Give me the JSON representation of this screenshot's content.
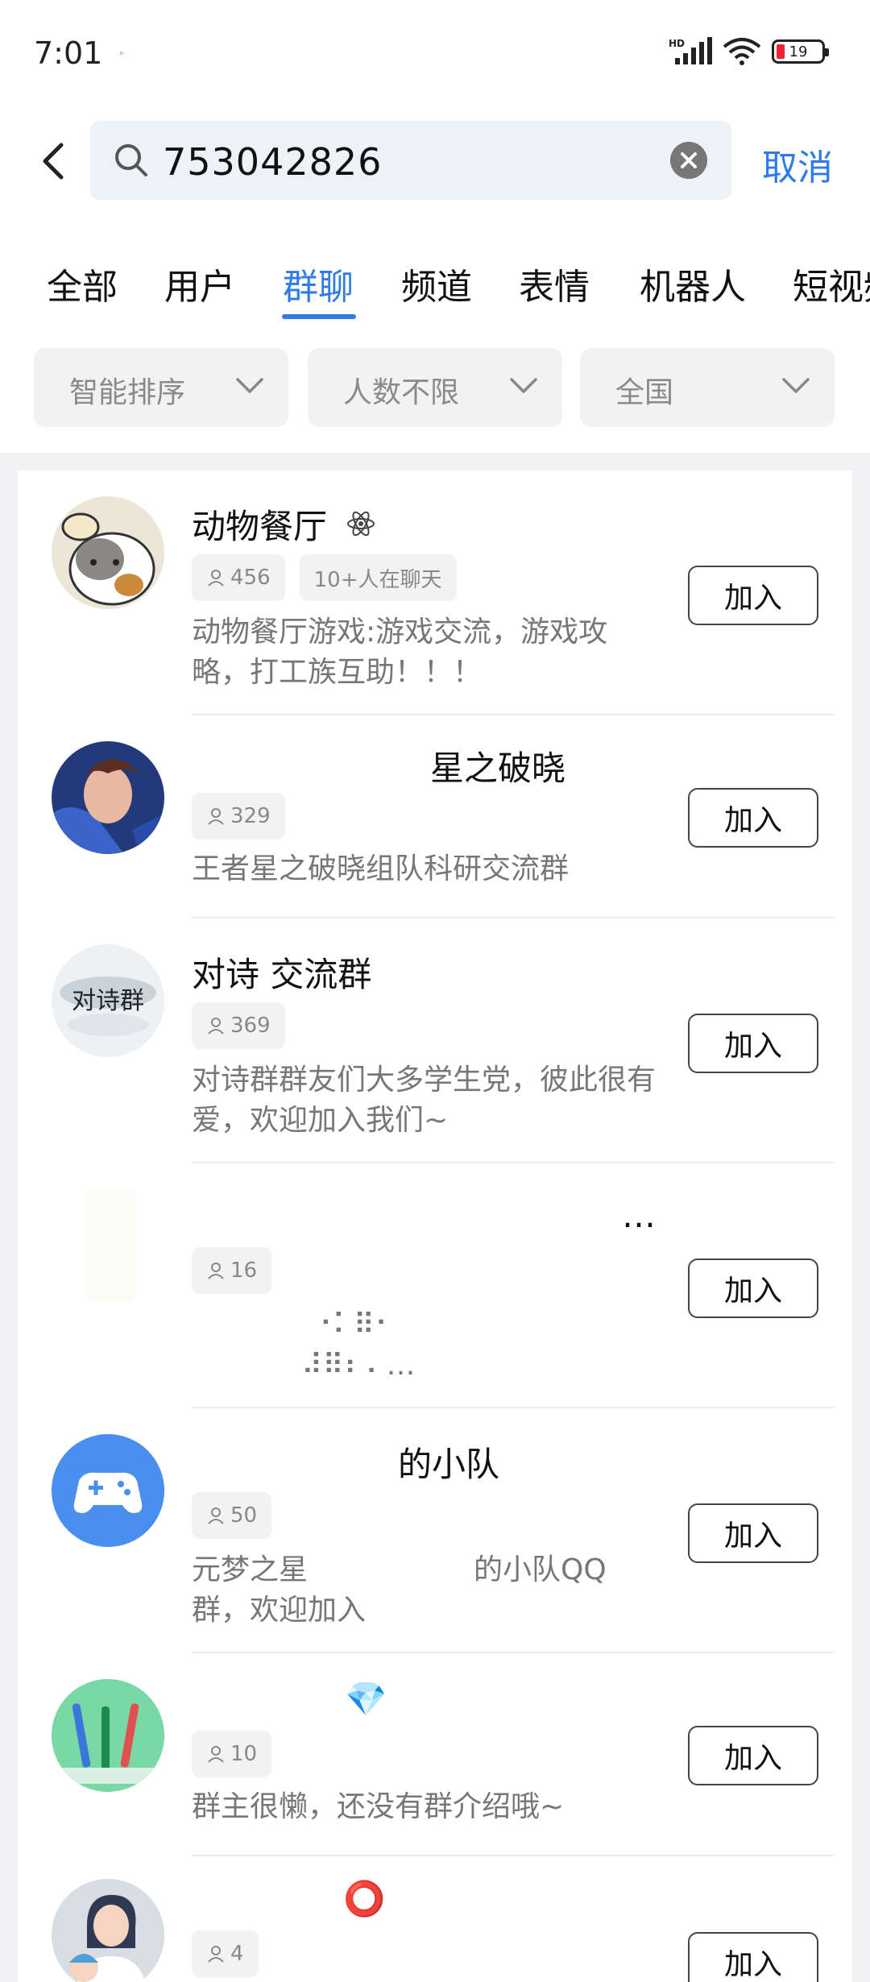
{
  "status_bar": {
    "time": "7:01",
    "tiny_icon": "ᐢ",
    "network": "HD",
    "battery": "19"
  },
  "search": {
    "query": "753042826",
    "cancel_label": "取消"
  },
  "tabs": [
    {
      "label": "全部"
    },
    {
      "label": "用户"
    },
    {
      "label": "群聊"
    },
    {
      "label": "频道"
    },
    {
      "label": "表情"
    },
    {
      "label": "机器人"
    },
    {
      "label": "短视频"
    }
  ],
  "active_tab": "群聊",
  "filters": [
    {
      "label": "智能排序"
    },
    {
      "label": "人数不限"
    },
    {
      "label": "全国"
    }
  ],
  "groups": [
    {
      "name": "动物餐厅",
      "name_suffix_icon": "atom-icon",
      "members": "456",
      "chatting": "10+人在聊天",
      "description": "动物餐厅游戏:游戏交流，游戏攻略，打工族互助！！！",
      "join_label": "加入"
    },
    {
      "name": "星之破晓",
      "members": "329",
      "description": "王者星之破晓组队科研交流群",
      "join_label": "加入"
    },
    {
      "name": "对诗 交流群",
      "avatar_text": "对诗群",
      "members": "369",
      "description": "对诗群群友们大多学生党，彼此很有爱，欢迎加入我们~",
      "join_label": "加入"
    },
    {
      "name": "…",
      "members": "16",
      "description_line1": "⠐⠅⠿⠂",
      "description_line2": "⠼⠿⠆⠄…",
      "join_label": "加入"
    },
    {
      "name": "的小队",
      "members": "50",
      "description_line1": "元梦之星",
      "description_line1b": "的小队QQ",
      "description_line2": "群，欢迎加入",
      "join_label": "加入"
    },
    {
      "name": "💎",
      "members": "10",
      "description": "群主很懒，还没有群介绍哦~",
      "join_label": "加入"
    },
    {
      "name": "⭕",
      "members": "4",
      "join_label": "加入"
    }
  ]
}
